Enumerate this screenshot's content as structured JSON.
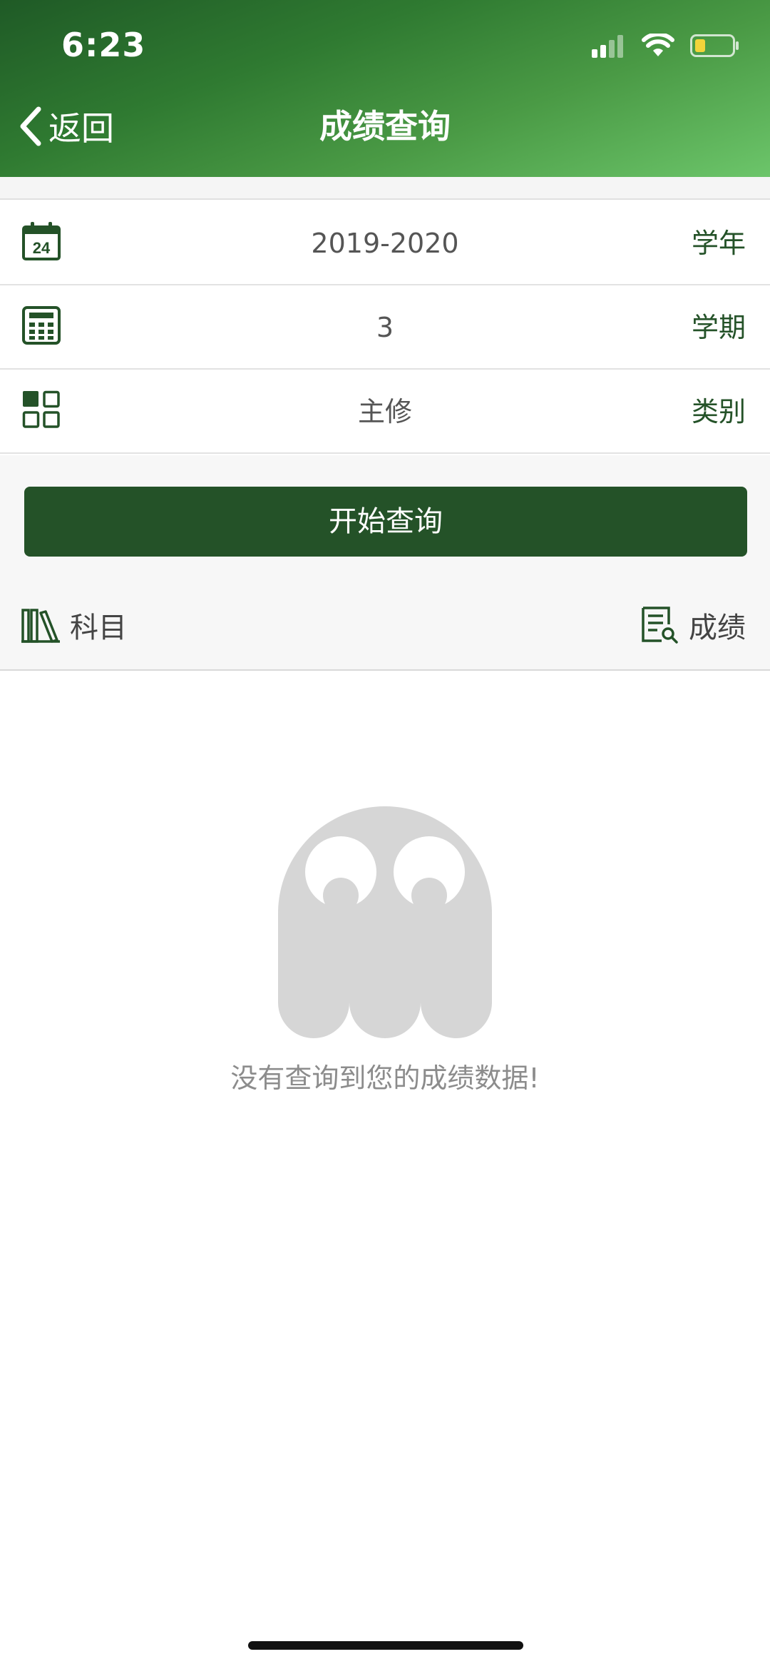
{
  "status_bar": {
    "time": "6:23"
  },
  "nav": {
    "back_label": "返回",
    "title": "成绩查询"
  },
  "filters": [
    {
      "value": "2019-2020",
      "label": "学年",
      "icon": "calendar-24-icon"
    },
    {
      "value": "3",
      "label": "学期",
      "icon": "calculator-icon"
    },
    {
      "value": "主修",
      "label": "类别",
      "icon": "grid-icon"
    }
  ],
  "query_button": {
    "label": "开始查询"
  },
  "results_header": {
    "left_label": "科目",
    "right_label": "成绩"
  },
  "empty_state": {
    "message": "没有查询到您的成绩数据!"
  },
  "colors": {
    "primary_dark": "#245228",
    "header_gradient_end": "#6cc56a",
    "battery_level_color": "#f2d43a"
  }
}
